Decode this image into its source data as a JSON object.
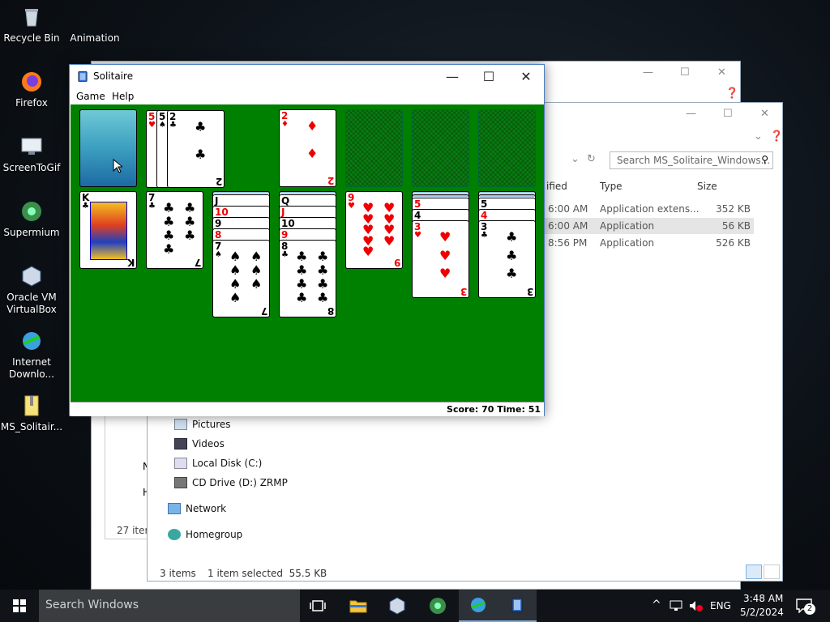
{
  "desktop": {
    "icons": [
      {
        "label": "Recycle Bin",
        "icon": "recycle-bin-icon"
      },
      {
        "label": "Animation",
        "icon": "animation-icon"
      },
      {
        "label": "Firefox",
        "icon": "firefox-icon"
      },
      {
        "label": "ScreenToGif",
        "icon": "screentogif-icon"
      },
      {
        "label": "Supermium",
        "icon": "supermium-icon"
      },
      {
        "label": "Oracle VM VirtualBox",
        "icon": "virtualbox-icon"
      },
      {
        "label": "Internet Downlo...",
        "icon": "idm-icon"
      },
      {
        "label": "MS_Solitair...",
        "icon": "zip-icon"
      }
    ]
  },
  "explorer": {
    "search_placeholder": "Search MS_Solitaire_Windows...",
    "columns": {
      "modified": "ified",
      "type": "Type",
      "size": "Size"
    },
    "files": [
      {
        "modified": "6:00 AM",
        "type": "Application extens...",
        "size": "352 KB"
      },
      {
        "modified": "6:00 AM",
        "type": "Application",
        "size": "56 KB"
      },
      {
        "modified": "8:56 PM",
        "type": "Application",
        "size": "526 KB"
      }
    ],
    "nav": [
      "Pictures",
      "Videos",
      "Local Disk (C:)",
      "CD Drive (D:) ZRMP",
      "Network",
      "Homegroup"
    ],
    "back_status": "27 item",
    "side_letters": [
      "N",
      "H"
    ],
    "status": {
      "count": "3 items",
      "selected": "1 item selected  55.5 KB"
    }
  },
  "solitaire": {
    "title": "Solitaire",
    "menu": [
      "Game",
      "Help"
    ],
    "score_label": "Score: 70 Time: 51",
    "waste": [
      {
        "rank": "5",
        "suit": "♥",
        "color": "red"
      },
      {
        "rank": "5",
        "suit": "♠",
        "color": "blk"
      },
      {
        "rank": "2",
        "suit": "♣",
        "color": "blk"
      }
    ],
    "foundation": [
      {
        "rank": "2",
        "suit": "♦",
        "color": "red"
      }
    ],
    "tableau": [
      {
        "face_up": [
          {
            "rank": "K",
            "suit": "♣",
            "color": "blk"
          }
        ]
      },
      {
        "face_up": [
          {
            "rank": "7",
            "suit": "♣",
            "color": "blk"
          }
        ]
      },
      {
        "face_up": [
          {
            "rank": "J",
            "suit": "♥",
            "color": "blk"
          },
          {
            "rank": "10",
            "suit": "♥",
            "color": "red"
          },
          {
            "rank": "9",
            "suit": "♠",
            "color": "blk"
          },
          {
            "rank": "8",
            "suit": "♥",
            "color": "red"
          },
          {
            "rank": "7",
            "suit": "♠",
            "color": "blk"
          }
        ]
      },
      {
        "face_up": [
          {
            "rank": "Q",
            "suit": "♠",
            "color": "blk"
          },
          {
            "rank": "J",
            "suit": "♥",
            "color": "red"
          },
          {
            "rank": "10",
            "suit": "♠",
            "color": "blk"
          },
          {
            "rank": "9",
            "suit": "♥",
            "color": "red"
          },
          {
            "rank": "8",
            "suit": "♣",
            "color": "blk"
          }
        ]
      },
      {
        "face_up": [
          {
            "rank": "9",
            "suit": "♥",
            "color": "red"
          }
        ]
      },
      {
        "face_up": [
          {
            "rank": "5",
            "suit": "♠",
            "color": "red"
          },
          {
            "rank": "4",
            "suit": "♠",
            "color": "blk"
          },
          {
            "rank": "3",
            "suit": "♥",
            "color": "red"
          }
        ]
      },
      {
        "face_up": [
          {
            "rank": "5",
            "suit": "♠",
            "color": "blk"
          },
          {
            "rank": "4",
            "suit": "♥",
            "color": "red"
          },
          {
            "rank": "3",
            "suit": "♣",
            "color": "blk"
          }
        ]
      }
    ]
  },
  "taskbar": {
    "search_placeholder": "Search Windows",
    "lang": "ENG",
    "time": "3:48 AM",
    "date": "5/2/2024",
    "notification_count": "2"
  }
}
